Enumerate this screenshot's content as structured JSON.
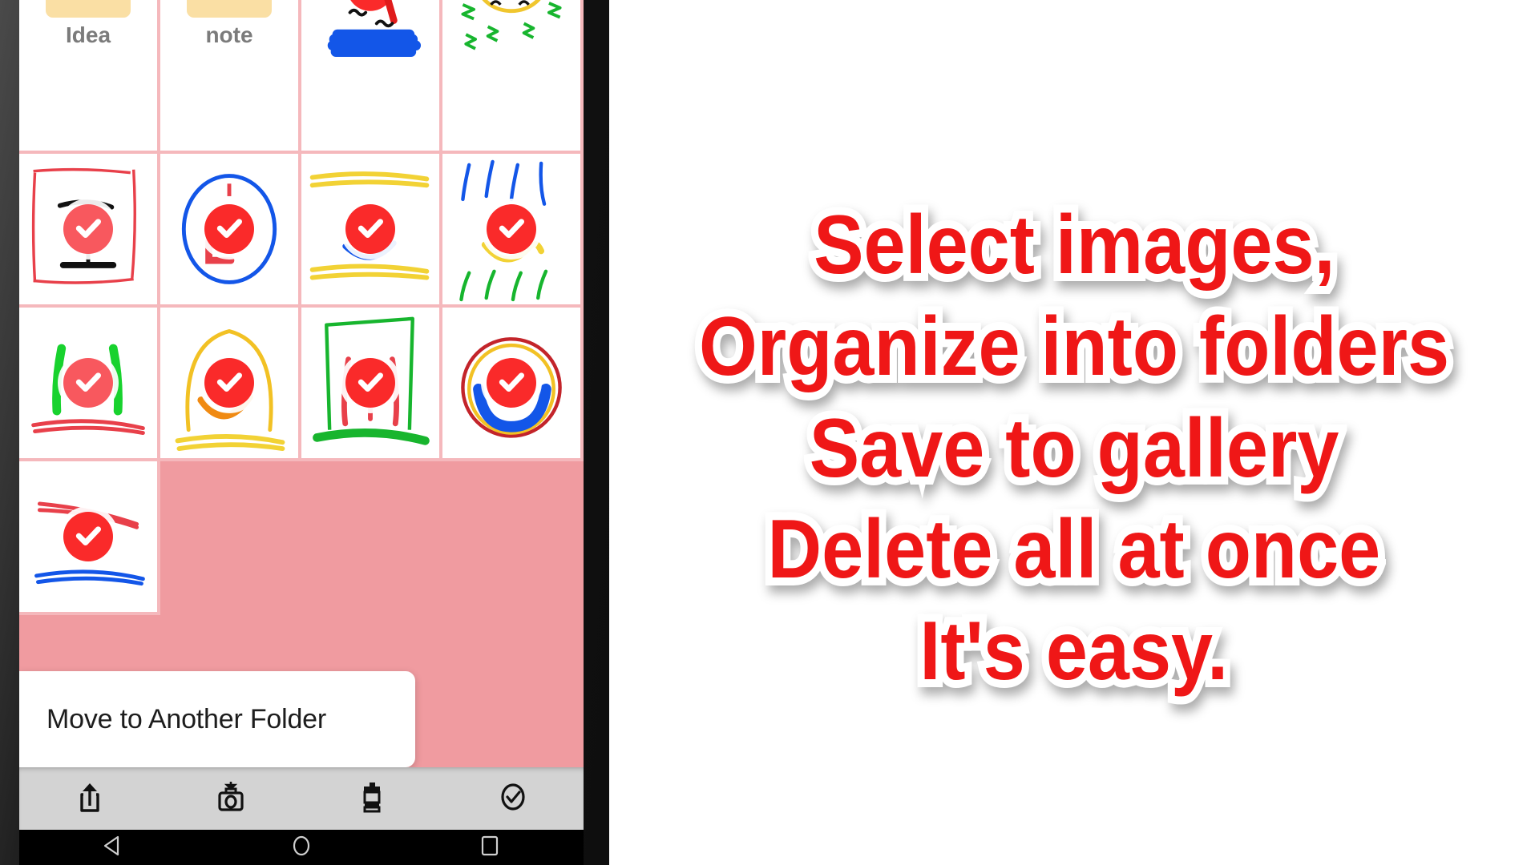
{
  "device": {
    "bezel_color": "#1a1a1a",
    "screen_bg_color": "#f09ba0",
    "grid_line_color": "#f5b8bc"
  },
  "app": {
    "grid": {
      "rows": [
        [
          {
            "type": "folder",
            "label": "Idea",
            "selected": false
          },
          {
            "type": "folder",
            "label": "note",
            "selected": false
          },
          {
            "type": "sketch",
            "selected": false,
            "strokes": "blue-scribble-face"
          },
          {
            "type": "sketch",
            "selected": false,
            "strokes": "green-zzz-sleep"
          }
        ],
        [
          {
            "type": "sketch",
            "selected": true,
            "strokes": "red-frame-black-table"
          },
          {
            "type": "sketch",
            "selected": true,
            "strokes": "blue-oval-red-mouth"
          },
          {
            "type": "sketch",
            "selected": true,
            "strokes": "yellow-lines-blue-smile"
          },
          {
            "type": "sketch",
            "selected": true,
            "strokes": "blue-rain-yellow-green"
          }
        ],
        [
          {
            "type": "sketch",
            "selected": true,
            "strokes": "green-legs-red-underline"
          },
          {
            "type": "sketch",
            "selected": true,
            "strokes": "yellow-arch-orange-smile"
          },
          {
            "type": "sketch",
            "selected": true,
            "strokes": "green-box-red-legs"
          },
          {
            "type": "sketch",
            "selected": true,
            "strokes": "red-yellow-rings-blue-smile"
          }
        ],
        [
          {
            "type": "sketch",
            "selected": true,
            "strokes": "red-strike-blue-underline"
          },
          {
            "type": "empty"
          },
          {
            "type": "empty"
          },
          {
            "type": "empty"
          }
        ]
      ]
    },
    "toast": {
      "message": "Move to Another Folder"
    },
    "action_bar": {
      "buttons": [
        {
          "name": "share-icon",
          "label": "Share"
        },
        {
          "name": "save-to-gallery-icon",
          "label": "Save to gallery"
        },
        {
          "name": "delete-icon",
          "label": "Delete"
        },
        {
          "name": "select-all-icon",
          "label": "Select all"
        }
      ]
    },
    "nav_bar": {
      "buttons": [
        {
          "name": "back-icon",
          "label": "Back"
        },
        {
          "name": "home-icon",
          "label": "Home"
        },
        {
          "name": "recents-icon",
          "label": "Recents"
        }
      ]
    }
  },
  "promo": {
    "text_color": "#ef1717",
    "outline_color": "#ffffff",
    "lines": [
      "Select images,",
      "Organize into folders",
      "Save to gallery",
      "Delete all at once",
      "It's easy."
    ]
  }
}
